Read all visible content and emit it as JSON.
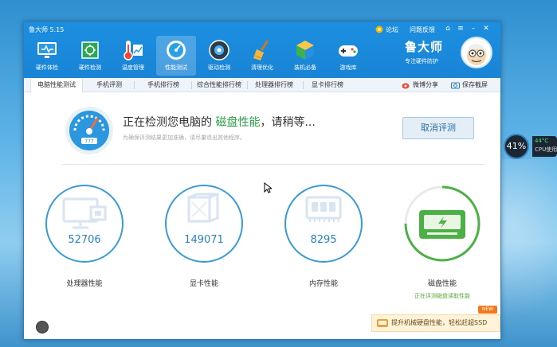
{
  "window": {
    "title": "鲁大师 5.15"
  },
  "titlebar_links": {
    "forum": "论坛",
    "feedback": "问题反馈"
  },
  "toolbar": [
    {
      "label": "硬件体检",
      "icon": "monitor-health-icon"
    },
    {
      "label": "硬件检测",
      "icon": "chip-icon"
    },
    {
      "label": "温度管理",
      "icon": "thermometer-icon"
    },
    {
      "label": "性能测试",
      "icon": "speedometer-icon"
    },
    {
      "label": "驱动检测",
      "icon": "driver-disc-icon"
    },
    {
      "label": "清理优化",
      "icon": "broom-icon"
    },
    {
      "label": "装机必备",
      "icon": "package-cube-icon"
    },
    {
      "label": "游戏库",
      "icon": "gamepad-icon"
    }
  ],
  "brand": {
    "name": "鲁大师",
    "slogan": "专注硬件防护"
  },
  "tabs": [
    "电脑性能测试",
    "手机评测",
    "手机排行榜",
    "综合性能排行榜",
    "处理器排行榜",
    "显卡排行榜"
  ],
  "tab_links": {
    "share": "微博分享",
    "save": "保存截屏"
  },
  "status": {
    "prefix": "正在检测您电脑的 ",
    "highlight": "磁盘性能",
    "suffix": "，请稍等...",
    "tip": "为确保评测结果更加准确，请尽量退出其他程序。",
    "cancel": "取消评测",
    "gauge_text": "777"
  },
  "metrics": [
    {
      "value": "52706",
      "label": "处理器性能",
      "icon": "monitor-cpu-icon"
    },
    {
      "value": "149071",
      "label": "显卡性能",
      "icon": "graphics-card-icon"
    },
    {
      "value": "8295",
      "label": "内存性能",
      "icon": "memory-chip-icon"
    }
  ],
  "disk": {
    "label": "磁盘性能",
    "sub": "正在评测磁盘读取性能"
  },
  "promo": {
    "text": "提升机械硬盘性能，轻松赶超SSD",
    "badge": "NEW"
  },
  "cpu_widget": {
    "percent": "41%",
    "temp": "44°C",
    "caption": "CPU使用"
  },
  "colors": {
    "accent": "#1a84d6",
    "highlight": "#2aa149",
    "ring": "#3a9ad9"
  }
}
